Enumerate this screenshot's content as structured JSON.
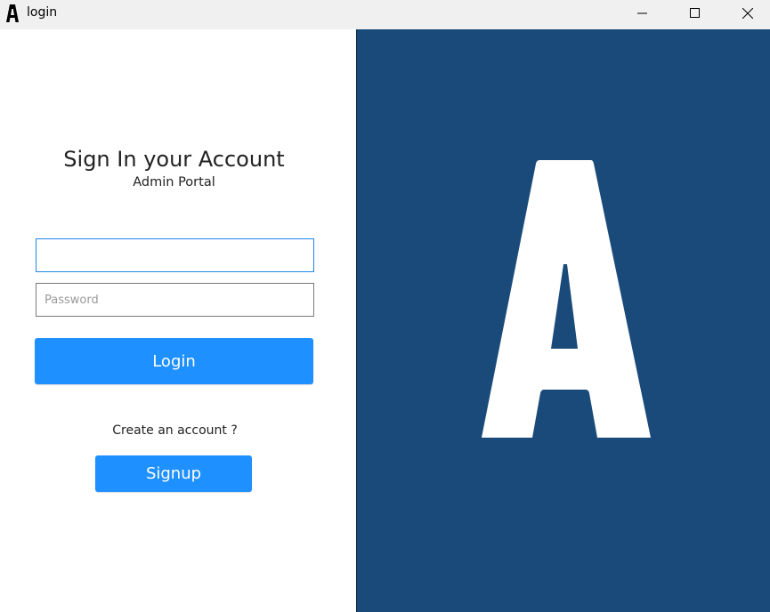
{
  "window": {
    "title": "login",
    "controls": {
      "minimize": "minimize-icon",
      "maximize": "maximize-icon",
      "close": "close-icon"
    }
  },
  "form": {
    "heading": "Sign In your Account",
    "subheading": "Admin Portal",
    "username_value": "",
    "password_placeholder": "Password",
    "login_label": "Login",
    "create_account_text": "Create an account ?",
    "signup_label": "Signup"
  },
  "brand": {
    "logo_icon": "letter-a-logo",
    "panel_color": "#1a4a7a",
    "accent_color": "#1e90ff"
  }
}
